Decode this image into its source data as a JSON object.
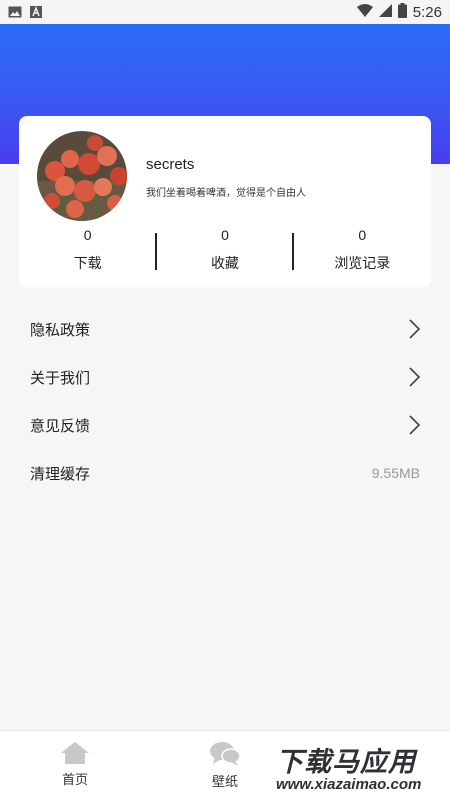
{
  "status_bar": {
    "time": "5:26",
    "icons": [
      "image-icon",
      "a-icon",
      "wifi-icon",
      "signal-icon",
      "battery-icon"
    ]
  },
  "profile": {
    "username": "secrets",
    "motto": "我们坐着喝着啤酒，觉得是个自由人",
    "avatar": "rose-bouquet-photo"
  },
  "stats": [
    {
      "value": "0",
      "label": "下载"
    },
    {
      "value": "0",
      "label": "收藏"
    },
    {
      "value": "0",
      "label": "浏览记录"
    }
  ],
  "menu": [
    {
      "label": "隐私政策",
      "icon": "chevron-right-icon"
    },
    {
      "label": "关于我们",
      "icon": "chevron-right-icon"
    },
    {
      "label": "意见反馈",
      "icon": "chevron-right-icon"
    },
    {
      "label": "清理缓存",
      "value": "9.55MB"
    }
  ],
  "tabbar": [
    {
      "label": "首页",
      "icon": "home-icon"
    },
    {
      "label": "壁纸",
      "icon": "chat-bubbles-icon"
    },
    {
      "label": "",
      "icon": "profile-icon"
    }
  ],
  "watermark": {
    "main": "下载马应用",
    "sub": "www.xiazaimao.com"
  },
  "colors": {
    "header_top": "#2a6df6",
    "header_bottom": "#4a3cf0",
    "icon_gray": "#c8c8c8"
  }
}
